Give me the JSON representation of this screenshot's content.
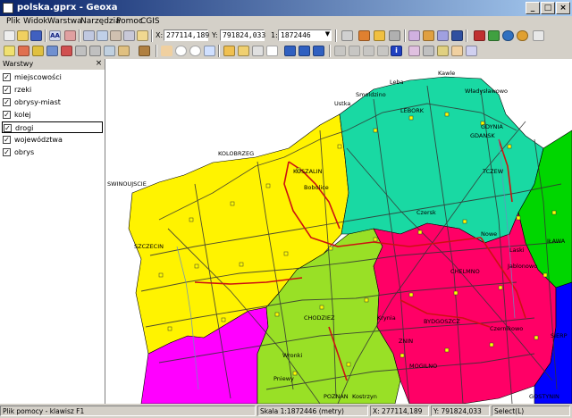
{
  "window": {
    "title": "polska.gprx - Geoxa",
    "buttons": {
      "minimize": "_",
      "maximize": "□",
      "close": "×"
    }
  },
  "menu": [
    "Plik",
    "Widok",
    "Warstwa",
    "Narzędzia",
    "Pomoc",
    "CGIS"
  ],
  "toolbar": {
    "x_label": "X:",
    "x_value": "277114,189",
    "y_label": "Y:",
    "y_value": "791824,033",
    "scale_label": "1:",
    "scale_value": "1872446",
    "info_icon": "i"
  },
  "layers_panel": {
    "title": "Warstwy",
    "close": "×",
    "layers": [
      {
        "name": "miejscowości",
        "checked": true,
        "selected": false
      },
      {
        "name": "rzeki",
        "checked": true,
        "selected": false
      },
      {
        "name": "obrysy-miast",
        "checked": true,
        "selected": false
      },
      {
        "name": "kolej",
        "checked": true,
        "selected": false
      },
      {
        "name": "drogi",
        "checked": true,
        "selected": true
      },
      {
        "name": "województwa",
        "checked": true,
        "selected": false
      },
      {
        "name": "obrys",
        "checked": true,
        "selected": false
      }
    ]
  },
  "map": {
    "labels": {
      "kawle": "Kawle",
      "leba": "Leba",
      "wladyslawowo": "Władysławowo",
      "smoldzino": "Smoldzino",
      "ustka": "Ustka",
      "lebork": "LEBORK",
      "gdynia": "GDYNIA",
      "gdansk": "GDANSK",
      "kolobrzeg": "KOLOBRZEG",
      "koszalin": "KOSZALIN",
      "bobolice": "Bobolice",
      "tczew": "TCZEW",
      "swinoujscie": "SWINOUJSCIE",
      "czersk": "Czersk",
      "szczecin": "SZCZECIN",
      "nowe": "Nowe",
      "ilawa": "IŁAWA",
      "laski": "Laski",
      "jablonowo": "Jablonowo",
      "chelmno": "CHELMNO",
      "chodziez": "CHODZIEZ",
      "krynia": "Krynia",
      "bydgoszcz": "BYDGOSZCZ",
      "czernikowo": "Czernikowo",
      "znin": "ZNIN",
      "wronki": "Wronki",
      "mogilno": "MOGILNO",
      "pniewy": "Pniewy",
      "poznan": "POZNAN",
      "kostrzyn": "Kostrzyn",
      "gostynin": "GOSTYNIN",
      "sierp": "SIERP"
    },
    "region_colors": {
      "background": "#ffffff",
      "zachodniopomorskie": "#fff300",
      "pomorskie": "#19d9a3",
      "warminsko": "#00d600",
      "kujawsko": "#ff0066",
      "wielkopolskie": "#99e026",
      "lubuskie": "#ff00ff",
      "mazowieckie": "#0000ff",
      "road": "#333333",
      "main_road": "#cc1111",
      "settlement": "#ffff00"
    }
  },
  "statusbar": {
    "help": "Plik pomocy - klawisz F1",
    "scale": "Skala 1:1872446 (metry)",
    "x": "X: 277114,189",
    "y": "Y: 791824,033",
    "mode": "Select(L)"
  }
}
